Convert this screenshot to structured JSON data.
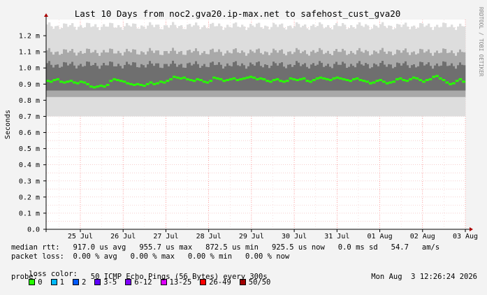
{
  "chart_data": {
    "type": "line",
    "title": "Last 10 Days from noc2.gva20.ip-max.net to safehost_cust_gva20",
    "ylabel": "Seconds",
    "side_label": "RRDTOOL / TOBI OETIKER",
    "ylim": [
      0.0,
      1.3
    ],
    "y_ticks": [
      "0.0",
      "0.1 m",
      "0.2 m",
      "0.3 m",
      "0.4 m",
      "0.5 m",
      "0.6 m",
      "0.7 m",
      "0.8 m",
      "0.9 m",
      "1.0 m",
      "1.1 m",
      "1.2 m"
    ],
    "x_ticks": [
      "25 Jul",
      "26 Jul",
      "27 Jul",
      "28 Jul",
      "29 Jul",
      "30 Jul",
      "31 Jul",
      "01 Aug",
      "02 Aug",
      "03 Aug"
    ],
    "grid": true,
    "series": [
      {
        "values": [
          0.92,
          0.915,
          0.925,
          0.93,
          0.915,
          0.91,
          0.915,
          0.92,
          0.91,
          0.905,
          0.915,
          0.91,
          0.9,
          0.885,
          0.88,
          0.885,
          0.89,
          0.885,
          0.895,
          0.92,
          0.93,
          0.925,
          0.92,
          0.915,
          0.905,
          0.9,
          0.895,
          0.9,
          0.895,
          0.89,
          0.9,
          0.91,
          0.9,
          0.905,
          0.915,
          0.91,
          0.92,
          0.93,
          0.945,
          0.94,
          0.935,
          0.94,
          0.93,
          0.925,
          0.92,
          0.93,
          0.925,
          0.915,
          0.91,
          0.92,
          0.94,
          0.935,
          0.93,
          0.92,
          0.925,
          0.93,
          0.935,
          0.925,
          0.93,
          0.935,
          0.94,
          0.945,
          0.94,
          0.93,
          0.935,
          0.93,
          0.92,
          0.915,
          0.925,
          0.93,
          0.92,
          0.915,
          0.92,
          0.935,
          0.93,
          0.925,
          0.93,
          0.935,
          0.92,
          0.915,
          0.925,
          0.935,
          0.94,
          0.935,
          0.93,
          0.925,
          0.935,
          0.94,
          0.935,
          0.93,
          0.925,
          0.92,
          0.93,
          0.935,
          0.925,
          0.92,
          0.915,
          0.905,
          0.91,
          0.92,
          0.925,
          0.915,
          0.905,
          0.91,
          0.915,
          0.93,
          0.935,
          0.925,
          0.92,
          0.93,
          0.94,
          0.935,
          0.925,
          0.915,
          0.925,
          0.93,
          0.945,
          0.95,
          0.935,
          0.925,
          0.91,
          0.9,
          0.905,
          0.92,
          0.93,
          0.915
        ]
      }
    ],
    "rtt_band": {
      "lower": 0.7,
      "inner_lower": 0.8,
      "inner_upper": 1.02,
      "upper": 1.26
    }
  },
  "stats": {
    "median_line": "median rtt:   917.0 us avg   955.7 us max   872.5 us min   925.5 us now   0.0 ms sd   54.7   am/s",
    "loss_line": "packet loss:  0.00 % avg   0.00 % max   0.00 % min   0.00 % now",
    "probe_line": "probe:            50 ICMP Echo Pings (56 Bytes) every 300s",
    "timestamp": "Mon Aug  3 12:26:24 2026"
  },
  "loss_legend": {
    "label": "loss color:",
    "items": [
      {
        "label": "0",
        "color": "#26ff00"
      },
      {
        "label": "1",
        "color": "#00b8ff"
      },
      {
        "label": "2",
        "color": "#0059ff"
      },
      {
        "label": "3-5",
        "color": "#5e00ff"
      },
      {
        "label": "6-12",
        "color": "#7e00ff"
      },
      {
        "label": "13-25",
        "color": "#dd00ff"
      },
      {
        "label": "26-49",
        "color": "#ff0000"
      },
      {
        "label": "50/50",
        "color": "#a10000"
      }
    ]
  }
}
